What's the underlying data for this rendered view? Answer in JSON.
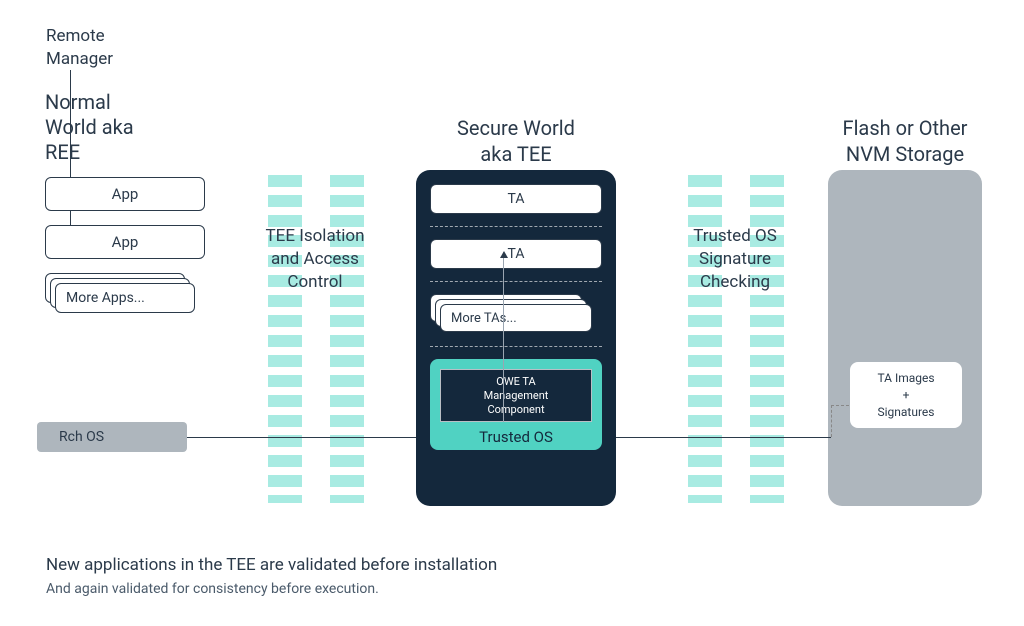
{
  "remote_manager_label": "Remote\nManager",
  "ree": {
    "title": "Normal\nWorld aka\nREE",
    "app1": "App",
    "app2": "App",
    "more_apps": "More Apps...",
    "rch_os": "Rch OS"
  },
  "wall1_label": "TEE Isolation\nand Access\nControl",
  "tee": {
    "title": "Secure World\naka TEE",
    "ta1": "TA",
    "ta2": "TA",
    "more_tas": "More TAs...",
    "owe": "OWE TA\nManagement\nComponent",
    "trusted_os": "Trusted OS"
  },
  "wall2_label": "Trusted OS\nSignature\nChecking",
  "nvm": {
    "title": "Flash or Other\nNVM Storage",
    "box": "TA Images\n+\nSignatures"
  },
  "footer": {
    "line1": "New applications in the TEE are validated before installation",
    "line2": "And again validated for consistency before execution."
  }
}
